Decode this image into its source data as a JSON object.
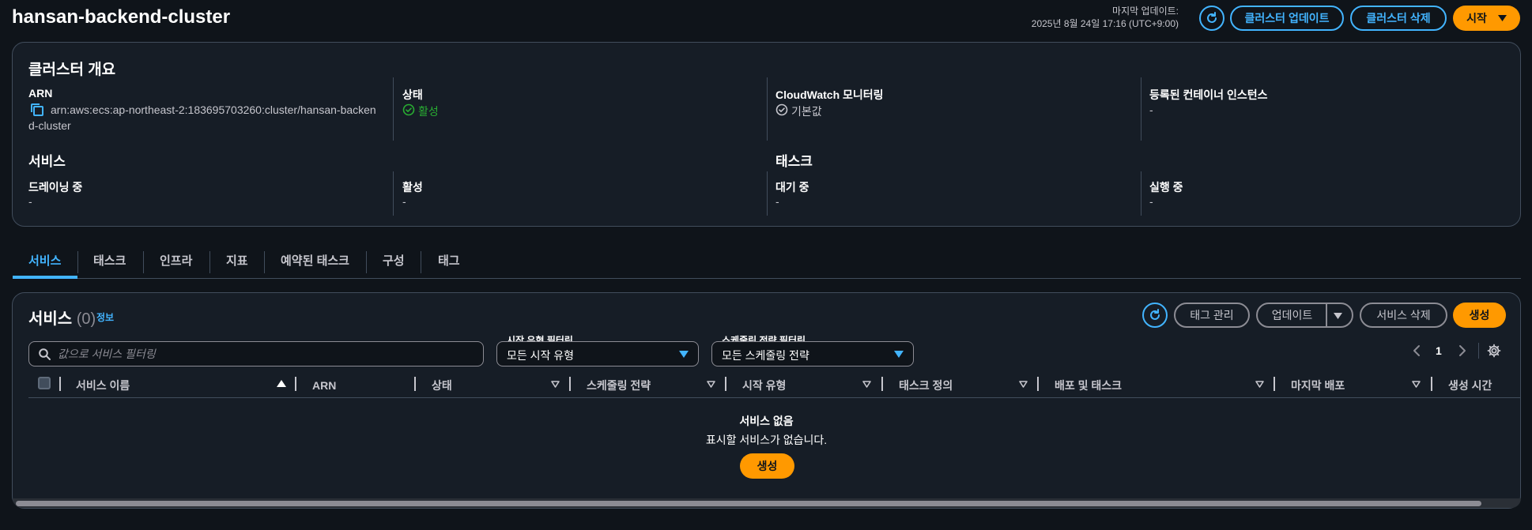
{
  "header": {
    "title": "hansan-backend-cluster",
    "last_update_label": "마지막 업데이트:",
    "last_update_value": "2025년 8월 24일 17:16 (UTC+9:00)",
    "update_cluster_label": "클러스터 업데이트",
    "delete_cluster_label": "클러스터 삭제",
    "start_label": "시작"
  },
  "overview": {
    "title": "클러스터 개요",
    "arn_label": "ARN",
    "arn_line1": "arn:aws:ecs:ap-northeast-2:183695703260:cluster/hansan-backen",
    "arn_line2": "d-cluster",
    "status_label": "상태",
    "status_value": "활성",
    "cloudwatch_label": "CloudWatch 모니터링",
    "cloudwatch_value": "기본값",
    "instances_label": "등록된 컨테이너 인스턴스",
    "instances_value": "-",
    "services_title": "서비스",
    "draining_label": "드레이닝 중",
    "draining_value": "-",
    "active_label": "활성",
    "active_value": "-",
    "tasks_title": "태스크",
    "pending_label": "대기 중",
    "pending_value": "-",
    "running_label": "실행 중",
    "running_value": "-"
  },
  "tabs": [
    "서비스",
    "태스크",
    "인프라",
    "지표",
    "예약된 태스크",
    "구성",
    "태그"
  ],
  "services": {
    "title": "서비스",
    "count": "(0)",
    "info_label": "정보",
    "manage_tags_label": "태그 관리",
    "update_label": "업데이트",
    "delete_service_label": "서비스 삭제",
    "create_label": "생성",
    "search_placeholder": "값으로 서비스 필터링",
    "launch_filter_label": "시작 유형 필터링",
    "launch_filter_value": "모든 시작 유형",
    "strategy_filter_label": "스케줄링 전략 필터링",
    "strategy_filter_value": "모든 스케줄링 전략",
    "page_number": "1",
    "columns": [
      "서비스 이름",
      "ARN",
      "상태",
      "스케줄링 전략",
      "시작 유형",
      "태스크 정의",
      "배포 및 태스크",
      "마지막 배포",
      "생성 시간"
    ],
    "empty_title": "서비스 없음",
    "empty_desc": "표시할 서비스가 없습니다.",
    "empty_create_label": "생성"
  },
  "colors": {
    "accent": "#42b4ff",
    "primary": "#ff9900",
    "success": "#29ad32",
    "background": "#0f141a",
    "panel": "#161d26"
  }
}
